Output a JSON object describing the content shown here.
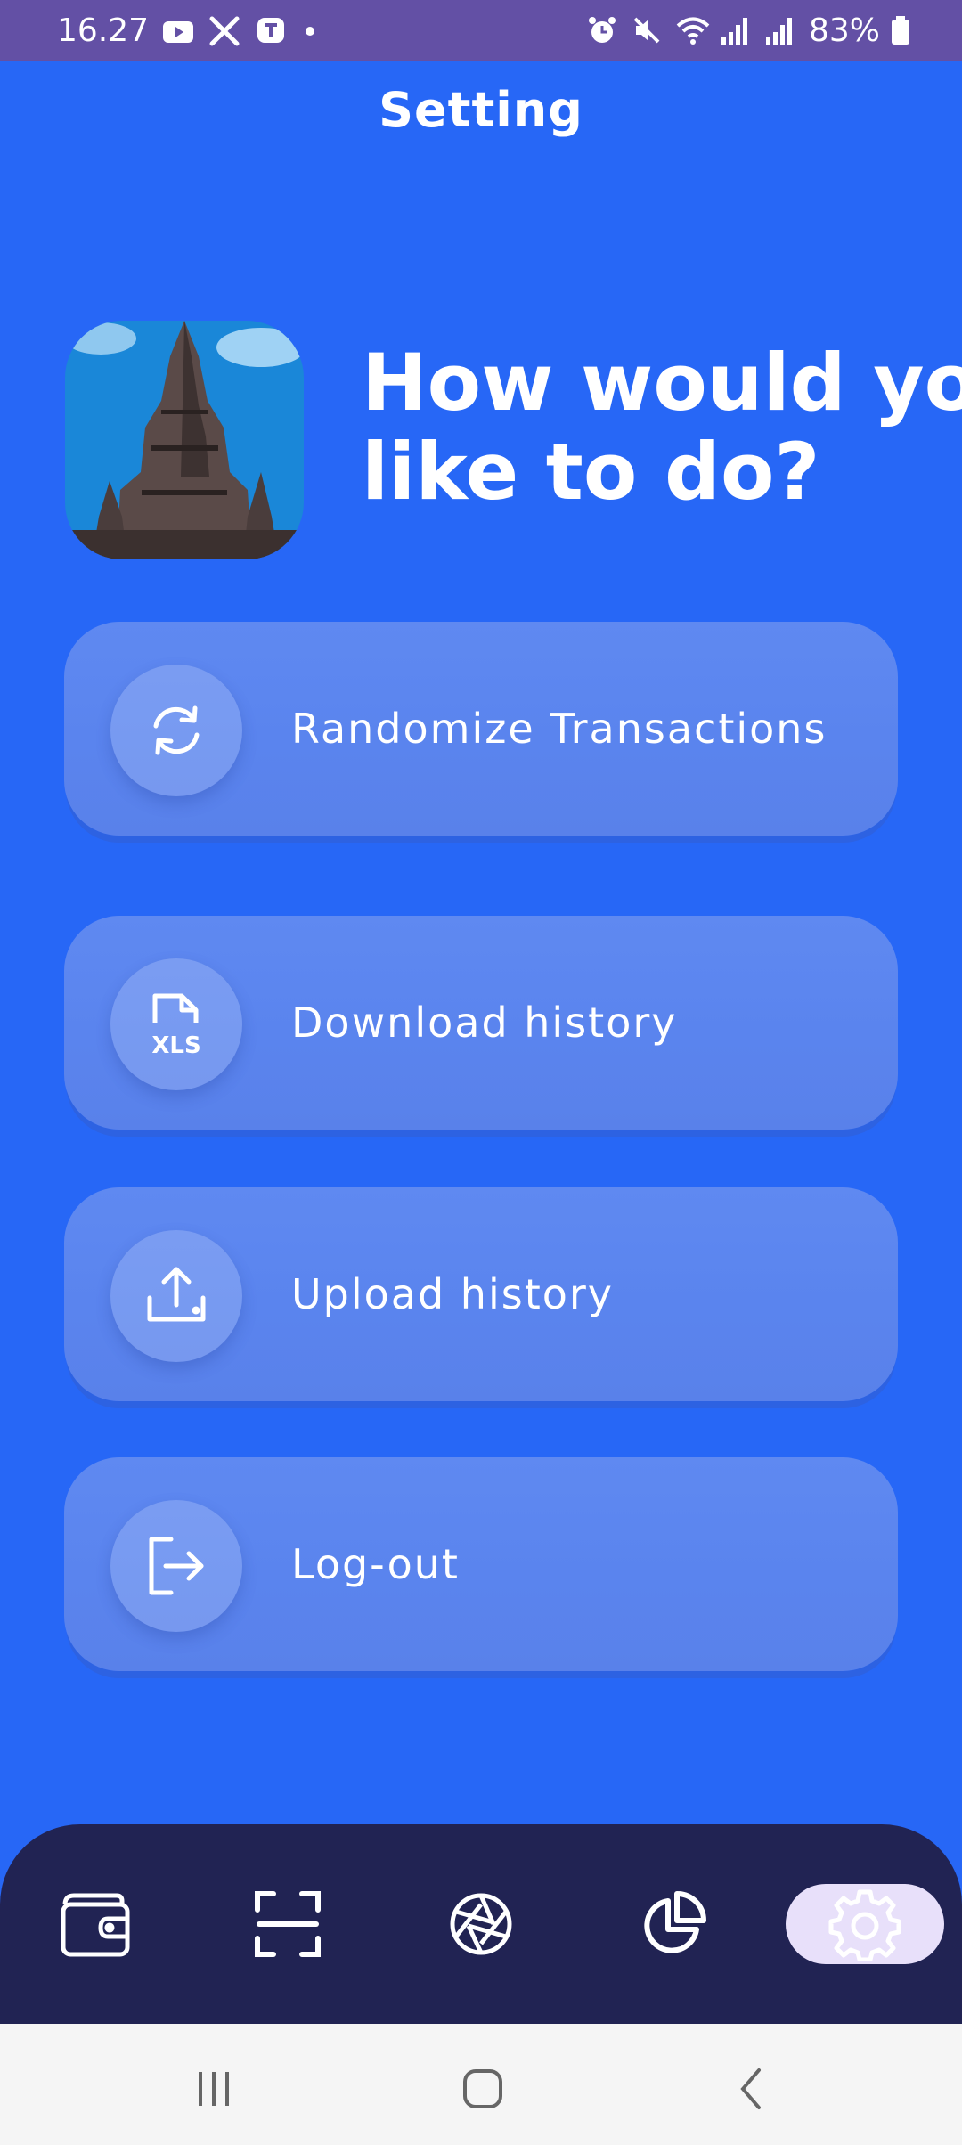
{
  "status_bar": {
    "time": "16.27",
    "battery_percent": "83%",
    "left_icons": [
      "youtube-icon",
      "x-icon",
      "app-icon",
      "notification-dot"
    ],
    "right_icons": [
      "alarm-icon",
      "mute-icon",
      "wifi-icon",
      "signal-icon",
      "signal-icon",
      "battery-icon"
    ]
  },
  "header": {
    "title": "Setting"
  },
  "hero": {
    "heading_line1": "How would yo",
    "heading_line2": "like to do?"
  },
  "options": [
    {
      "label": "Randomize Transactions",
      "icon": "refresh-icon"
    },
    {
      "label": "Download history",
      "icon": "xls-file-icon"
    },
    {
      "label": "Upload history",
      "icon": "upload-icon"
    },
    {
      "label": "Log-out",
      "icon": "logout-icon"
    }
  ],
  "bottom_nav": {
    "items": [
      "wallet-icon",
      "scan-icon",
      "camera-shutter-icon",
      "pie-chart-icon",
      "settings-icon"
    ],
    "active_index": 4
  },
  "colors": {
    "background": "#2767f6",
    "status_bar": "#6350a5",
    "card": "#5f89f1",
    "bottom_nav": "#212353",
    "active_pill": "#e8e0fa"
  }
}
